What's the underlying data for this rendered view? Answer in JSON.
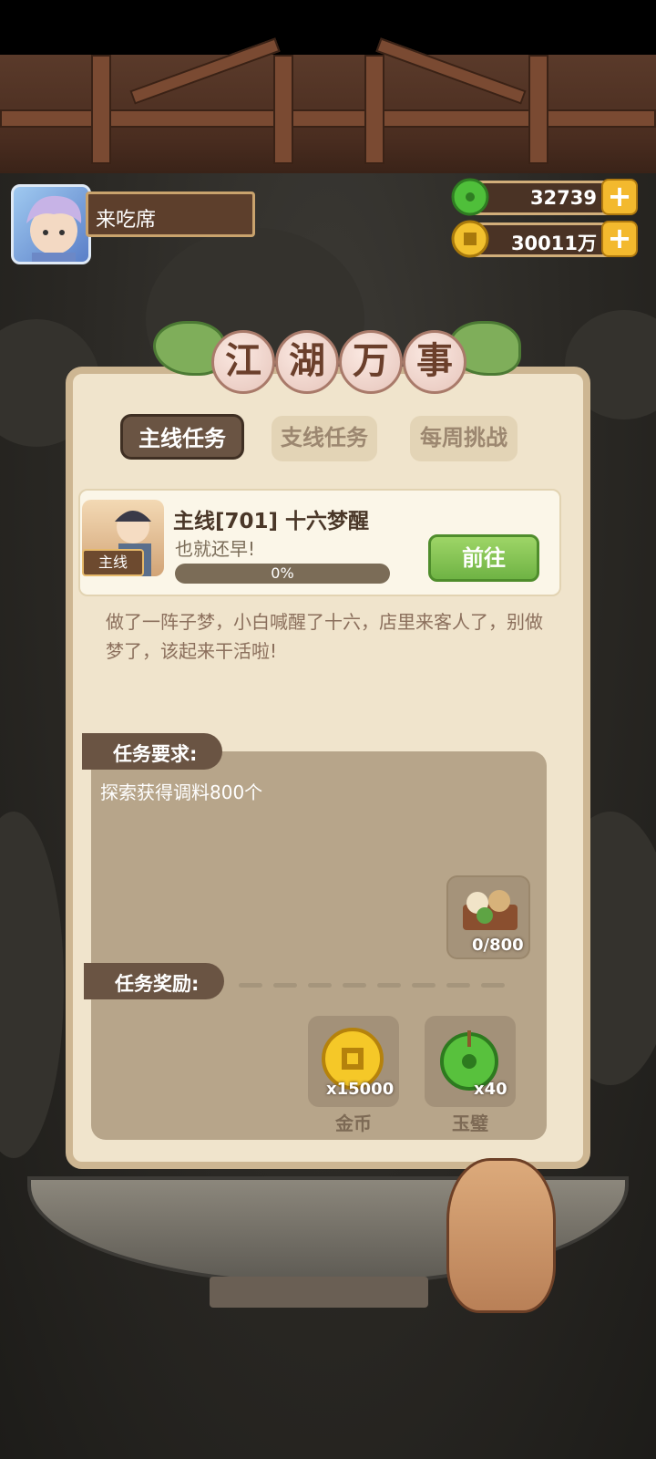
{
  "player": {
    "name": "来吃席"
  },
  "currency": {
    "jade": {
      "value": "32739",
      "icon": "jade-icon",
      "color": "#5fc44a"
    },
    "coin": {
      "value": "30011万",
      "icon": "coin-icon",
      "color": "#f2c12e"
    }
  },
  "panel": {
    "title_chars": [
      "江",
      "湖",
      "万",
      "事"
    ],
    "tabs": [
      {
        "label": "主线任务",
        "active": true
      },
      {
        "label": "支线任务",
        "active": false
      },
      {
        "label": "每周挑战",
        "active": false
      }
    ]
  },
  "quest": {
    "tag": "主线",
    "title": "主线[701]  十六梦醒",
    "subtitle": "也就还早!",
    "progress_text": "0%",
    "progress": 0,
    "go_label": "前往",
    "description": "做了一阵子梦，小白喊醒了十六，店里来客人了，别做梦了，该起来干活啦!"
  },
  "requirements": {
    "label": "任务要求:",
    "text": "探索获得调料800个",
    "item": {
      "icon": "seasoning-icon",
      "count": "0/800"
    }
  },
  "rewards": {
    "label": "任务奖励:",
    "items": [
      {
        "icon": "coin-icon",
        "count": "x15000",
        "name": "金币"
      },
      {
        "icon": "jade-icon",
        "count": "x40",
        "name": "玉璧"
      }
    ]
  }
}
